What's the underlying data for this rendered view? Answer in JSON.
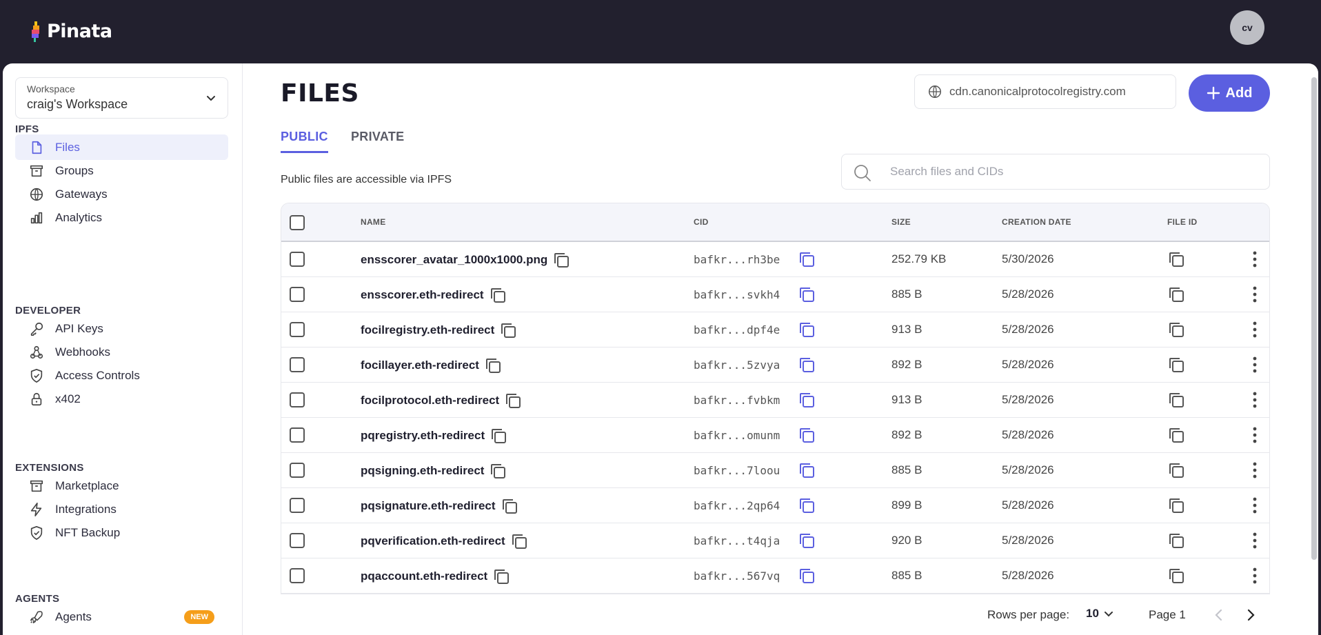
{
  "app": {
    "name": "Pinata",
    "user_initials": "cv"
  },
  "sidebar": {
    "workspace": {
      "label": "Workspace",
      "value": "craig's Workspace"
    },
    "sections": [
      {
        "title": "IPFS",
        "items": [
          {
            "label": "Files",
            "icon": "file-icon",
            "active": true
          },
          {
            "label": "Groups",
            "icon": "archive-icon"
          },
          {
            "label": "Gateways",
            "icon": "globe-icon"
          },
          {
            "label": "Analytics",
            "icon": "bar-chart-icon"
          }
        ]
      },
      {
        "title": "DEVELOPER",
        "items": [
          {
            "label": "API Keys",
            "icon": "key-icon"
          },
          {
            "label": "Webhooks",
            "icon": "webhook-icon"
          },
          {
            "label": "Access Controls",
            "icon": "shield-check-icon"
          },
          {
            "label": "x402",
            "icon": "lock-icon"
          }
        ]
      },
      {
        "title": "EXTENSIONS",
        "items": [
          {
            "label": "Marketplace",
            "icon": "archive-icon"
          },
          {
            "label": "Integrations",
            "icon": "bolt-icon"
          },
          {
            "label": "NFT Backup",
            "icon": "shield-check-icon"
          }
        ]
      },
      {
        "title": "AGENTS",
        "items": [
          {
            "label": "Agents",
            "icon": "rocket-icon",
            "badge": "NEW"
          }
        ]
      }
    ]
  },
  "header": {
    "title": "FILES",
    "gateway": "cdn.canonicalprotocolregistry.com",
    "add_label": "Add"
  },
  "tabs": [
    {
      "label": "PUBLIC",
      "active": true
    },
    {
      "label": "PRIVATE",
      "active": false
    }
  ],
  "description": "Public files are accessible via IPFS",
  "search": {
    "placeholder": "Search files and CIDs"
  },
  "table": {
    "columns": [
      "NAME",
      "CID",
      "SIZE",
      "CREATION DATE",
      "FILE ID"
    ],
    "rows": [
      {
        "name": "ensscorer_avatar_1000x1000.png",
        "cid": "bafkr...rh3be",
        "size": "252.79 KB",
        "date": "5/30/2026"
      },
      {
        "name": "ensscorer.eth-redirect",
        "cid": "bafkr...svkh4",
        "size": "885 B",
        "date": "5/28/2026"
      },
      {
        "name": "focilregistry.eth-redirect",
        "cid": "bafkr...dpf4e",
        "size": "913 B",
        "date": "5/28/2026"
      },
      {
        "name": "focillayer.eth-redirect",
        "cid": "bafkr...5zvya",
        "size": "892 B",
        "date": "5/28/2026"
      },
      {
        "name": "focilprotocol.eth-redirect",
        "cid": "bafkr...fvbkm",
        "size": "913 B",
        "date": "5/28/2026"
      },
      {
        "name": "pqregistry.eth-redirect",
        "cid": "bafkr...omunm",
        "size": "892 B",
        "date": "5/28/2026"
      },
      {
        "name": "pqsigning.eth-redirect",
        "cid": "bafkr...7loou",
        "size": "885 B",
        "date": "5/28/2026"
      },
      {
        "name": "pqsignature.eth-redirect",
        "cid": "bafkr...2qp64",
        "size": "899 B",
        "date": "5/28/2026"
      },
      {
        "name": "pqverification.eth-redirect",
        "cid": "bafkr...t4qja",
        "size": "920 B",
        "date": "5/28/2026"
      },
      {
        "name": "pqaccount.eth-redirect",
        "cid": "bafkr...567vq",
        "size": "885 B",
        "date": "5/28/2026"
      }
    ]
  },
  "pagination": {
    "rows_per_page_label": "Rows per page:",
    "rows_per_page_value": "10",
    "page_label": "Page 1"
  },
  "colors": {
    "accent": "#5b5fe0",
    "topbar": "#22202e",
    "badge": "#f59e1a"
  }
}
